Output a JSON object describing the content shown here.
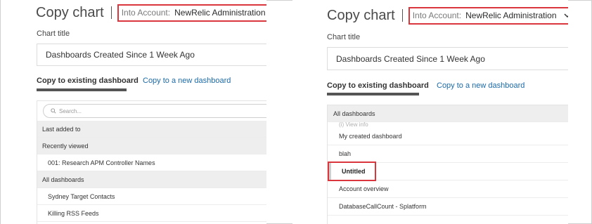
{
  "left": {
    "title": "Copy chart",
    "account": {
      "label": "Into Account:",
      "value": "NewRelic Administration"
    },
    "chart_title_label": "Chart title",
    "chart_title_value": "Dashboards Created Since 1 Week Ago",
    "tabs": {
      "existing": "Copy to existing dashboard",
      "new": "Copy to a new dashboard"
    },
    "search_placeholder": "Search...",
    "rows": [
      {
        "text": "Last added to",
        "kind": "group"
      },
      {
        "text": "Recently viewed",
        "kind": "group"
      },
      {
        "text": "001: Research APM Controller Names",
        "kind": "item"
      },
      {
        "text": "All dashboards",
        "kind": "group"
      },
      {
        "text": "Sydney Target Contacts",
        "kind": "item"
      },
      {
        "text": "Killing RSS Feeds",
        "kind": "item"
      }
    ]
  },
  "right": {
    "title": "Copy chart",
    "account": {
      "label": "Into Account:",
      "value": "NewRelic Administration"
    },
    "chart_title_label": "Chart title",
    "chart_title_value": "Dashboards Created Since 1 Week Ago",
    "tabs": {
      "existing": "Copy to existing dashboard",
      "new": "Copy to a new dashboard"
    },
    "group_header": "All dashboards",
    "faded_row": "(i) View info",
    "items": [
      "My created dashboard",
      "blah"
    ],
    "selected_item": "Untitled",
    "items_after": [
      "Account overview",
      "DatabaseCallCount - Splatform"
    ]
  },
  "colors": {
    "highlight": "#d9363e",
    "link": "#1b6aa8",
    "tab_underline": "#555555",
    "group_bg": "#eeeeee"
  },
  "icons": [
    "chevron-down-icon",
    "search-icon"
  ]
}
